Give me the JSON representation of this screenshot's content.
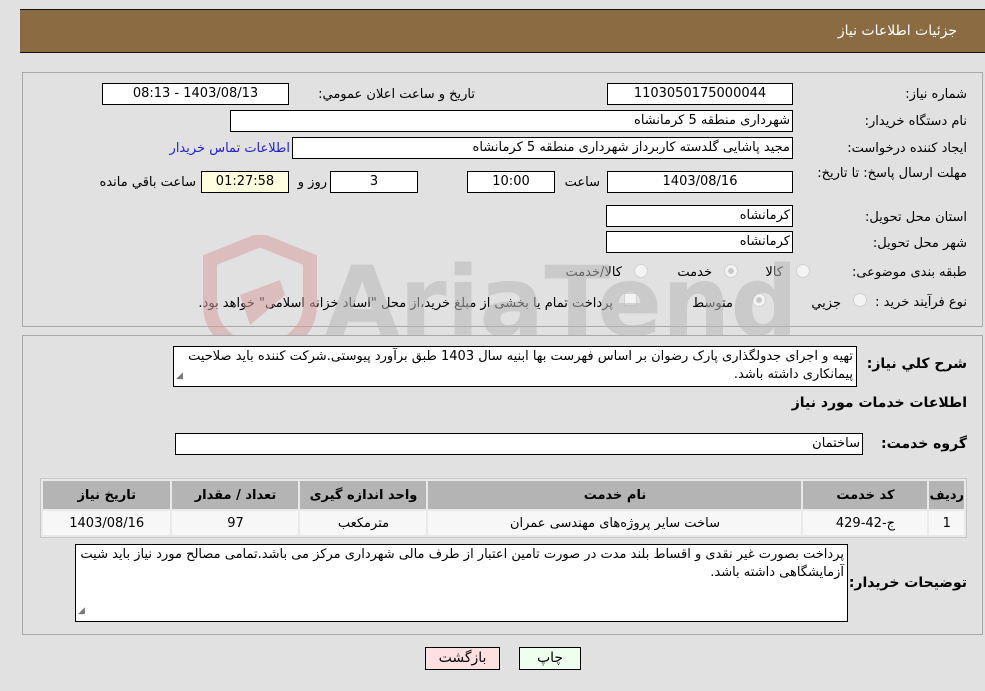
{
  "header": {
    "title": "جزئیات اطلاعات نیاز"
  },
  "form": {
    "need_number": {
      "label": "شماره نیاز:",
      "value": "1103050175000044"
    },
    "announce_datetime": {
      "label": "تاريخ و ساعت اعلان عمومي:",
      "value": "1403/08/13 - 08:13"
    },
    "buyer_org": {
      "label": "نام دستگاه خريدار:",
      "value": "شهرداری منطقه 5 کرمانشاه"
    },
    "requester": {
      "label": "ايجاد کننده درخواست:",
      "value": "مجید پاشایی گلدسته کاربرداز شهرداری منطقه 5 کرمانشاه",
      "contact_link": "اطلاعات تماس خريدار"
    },
    "deadline": {
      "label": "مهلت ارسال پاسخ: تا تاريخ:",
      "date": "1403/08/16",
      "time_label": "ساعت",
      "time": "10:00",
      "days": "3",
      "days_label": "روز و",
      "remaining": "01:27:58",
      "remaining_label": "ساعت باقي مانده"
    },
    "province": {
      "label": "استان محل تحويل:",
      "value": "کرمانشاه"
    },
    "city": {
      "label": "شهر محل تحويل:",
      "value": "کرمانشاه"
    },
    "category": {
      "label": "طبقه بندی موضوعی:",
      "options": [
        "کالا",
        "خدمت",
        "کالا/خدمت"
      ],
      "selected": "خدمت"
    },
    "purchase_type": {
      "label": "نوع فرآيند خريد :",
      "options": [
        "جزيي",
        "متوسط"
      ],
      "selected": "متوسط",
      "treasury_note": "پرداخت تمام يا بخشی از مبلغ خريد،از محل \"اسناد خزانه اسلامی\" خواهد بود."
    }
  },
  "description": {
    "label": "شرح کلي نياز:",
    "text": "تهیه و اجرای جدولگذاری پارک رضوان  بر اساس فهرست بها ابنیه سال 1403 طبق برآورد پیوستی.شرکت کننده باید صلاحیت پیمانکاری داشته باشد."
  },
  "services": {
    "section_title": "اطلاعات خدمات مورد نياز",
    "group_label": "گروه خدمت:",
    "group_value": "ساختمان",
    "columns": [
      "رديف",
      "کد خدمت",
      "نام خدمت",
      "واحد اندازه گيری",
      "تعداد / مقدار",
      "تاريخ نياز"
    ],
    "rows": [
      [
        "1",
        "ج-42-429",
        "ساخت سایر پروژه‌های مهندسی عمران",
        "مترمکعب",
        "97",
        "1403/08/16"
      ]
    ]
  },
  "buyer_notes": {
    "label": "توضيحات خريدار:",
    "text": "پرداخت بصورت غیر نقدی و اقساط بلند مدت در صورت تامین اعتبار از طرف مالی شهرداری مرکز می باشد.تمامی مصالح مورد نیاز باید شیت آزمایشگاهی داشته باشد."
  },
  "buttons": {
    "print": "چاپ",
    "back": "بازگشت"
  },
  "watermark": {
    "text": "AriaTender.neT"
  }
}
